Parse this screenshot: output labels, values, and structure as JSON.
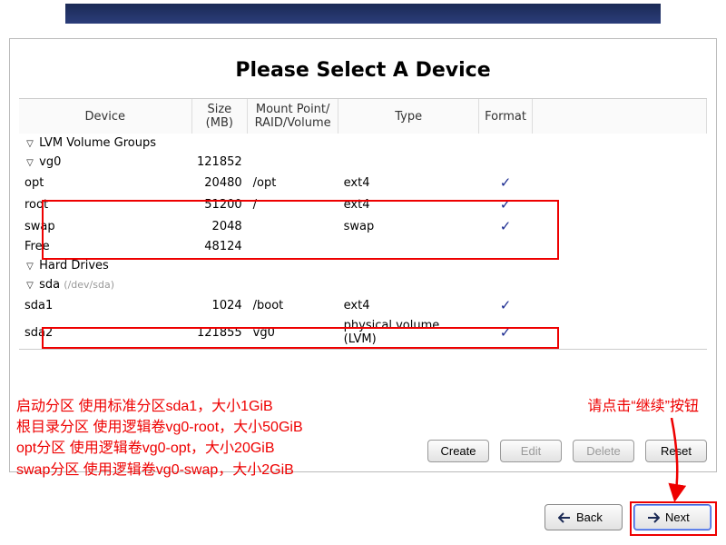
{
  "title": "Please Select A Device",
  "columns": {
    "device": "Device",
    "size": "Size\n(MB)",
    "mount": "Mount Point/\nRAID/Volume",
    "type": "Type",
    "format": "Format"
  },
  "sections": {
    "lvm_label": "LVM Volume Groups",
    "vg0": {
      "name": "vg0",
      "size": "121852",
      "rows": [
        {
          "name": "opt",
          "size": "20480",
          "mount": "/opt",
          "type": "ext4",
          "fmt": true
        },
        {
          "name": "root",
          "size": "51200",
          "mount": "/",
          "type": "ext4",
          "fmt": true
        },
        {
          "name": "swap",
          "size": "2048",
          "mount": "",
          "type": "swap",
          "fmt": true
        },
        {
          "name": "Free",
          "size": "48124",
          "mount": "",
          "type": "",
          "fmt": false
        }
      ]
    },
    "hd_label": "Hard Drives",
    "sda": {
      "name": "sda",
      "hint": "(/dev/sda)",
      "rows": [
        {
          "name": "sda1",
          "size": "1024",
          "mount": "/boot",
          "type": "ext4",
          "fmt": true
        },
        {
          "name": "sda2",
          "size": "121855",
          "mount": "vg0",
          "type": "physical volume (LVM)",
          "fmt": true
        }
      ]
    }
  },
  "buttons": {
    "create": "Create",
    "edit": "Edit",
    "delete": "Delete",
    "reset": "Reset",
    "back": "Back",
    "next": "Next"
  },
  "annotations": {
    "left1": "启动分区 使用标准分区sda1，大小1GiB",
    "left2": "根目录分区 使用逻辑卷vg0-root，大小50GiB",
    "left3": "opt分区 使用逻辑卷vg0-opt，大小20GiB",
    "left4": "swap分区 使用逻辑卷vg0-swap，大小2GiB",
    "right": "请点击“继续”按钮"
  }
}
